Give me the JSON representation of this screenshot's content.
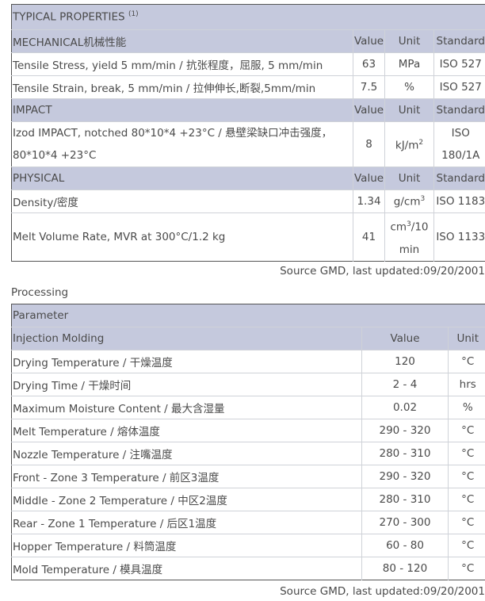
{
  "typical": {
    "title": "TYPICAL PROPERTIES ",
    "title_note": "(1)",
    "mechanical": {
      "heading": "MECHANICAL机械性能",
      "col_value": "Value",
      "col_unit": "Unit",
      "col_standard": "Standard",
      "rows": [
        {
          "prop": "Tensile Stress, yield 5 mm/min / 抗张程度，屈服, 5 mm/min",
          "value": "63",
          "unit": "MPa",
          "standard": "ISO 527"
        },
        {
          "prop": "Tensile Strain, break, 5 mm/min / 拉伸伸长,断裂,5mm/min",
          "value": "7.5",
          "unit": "%",
          "standard": "ISO 527"
        }
      ]
    },
    "impact": {
      "heading": "IMPACT",
      "col_value": "Value",
      "col_unit": "Unit",
      "col_standard": "Standard",
      "rows": [
        {
          "prop_line1": "Izod IMPACT, notched 80*10*4 +23°C / 悬壁梁缺口冲击强度，",
          "prop_line2": "80*10*4 +23°C",
          "value": "8",
          "unit_main": "kJ/m",
          "unit_sup": "2",
          "standard_line1": "ISO",
          "standard_line2": "180/1A"
        }
      ]
    },
    "physical": {
      "heading": "PHYSICAL",
      "col_value": "Value",
      "col_unit": "Unit",
      "col_standard": "Standard",
      "rows": [
        {
          "prop": "Density/密度",
          "value": "1.34",
          "unit_main": "g/cm",
          "unit_sup": "3",
          "standard": "ISO 1183"
        },
        {
          "prop": "Melt Volume Rate, MVR at 300°C/1.2 kg",
          "value": "41",
          "unit_line1_main": "cm",
          "unit_line1_sup": "3",
          "unit_line1_rest": "/10",
          "unit_line2": "min",
          "standard": "ISO 1133"
        }
      ]
    }
  },
  "source_1": "Source GMD, last updated:09/20/2001",
  "processing_label": "Processing",
  "processing": {
    "parameter_label": "Parameter",
    "section": "Injection Molding",
    "col_value": "Value",
    "col_unit": "Unit",
    "rows": [
      {
        "param": "Drying Temperature / 干燥温度",
        "value": "120",
        "unit": "°C"
      },
      {
        "param": "Drying Time / 干燥时间",
        "value": "2 - 4",
        "unit": "hrs"
      },
      {
        "param": "Maximum Moisture Content / 最大含湿量",
        "value": "0.02",
        "unit": "%"
      },
      {
        "param": "Melt Temperature / 熔体温度",
        "value": "290 - 320",
        "unit": "°C"
      },
      {
        "param": "Nozzle Temperature / 注嘴温度",
        "value": "280 - 310",
        "unit": "°C"
      },
      {
        "param": "Front - Zone 3 Temperature / 前区3温度",
        "value": "290 - 320",
        "unit": "°C"
      },
      {
        "param": "Middle - Zone 2 Temperature / 中区2温度",
        "value": "280 - 310",
        "unit": "°C"
      },
      {
        "param": "Rear - Zone 1 Temperature / 后区1温度",
        "value": "270 - 300",
        "unit": "°C"
      },
      {
        "param": "Hopper Temperature / 料筒温度",
        "value": "60 - 80",
        "unit": "°C"
      },
      {
        "param": "Mold Temperature / 模具温度",
        "value": "80 - 120",
        "unit": "°C"
      }
    ]
  },
  "source_2": "Source GMD, last updated:09/20/2001"
}
